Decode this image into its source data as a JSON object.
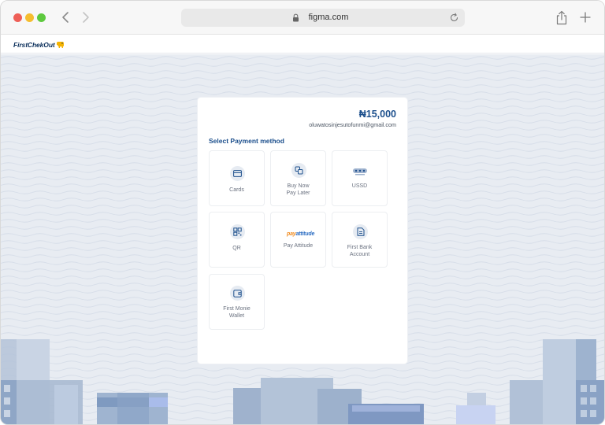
{
  "browser": {
    "url": "figma.com",
    "icons": [
      "back-chevron-icon",
      "forward-chevron-icon",
      "lock-icon",
      "reload-icon",
      "share-icon",
      "plus-icon"
    ]
  },
  "header": {
    "logo_text": "FirstChekOut"
  },
  "payment": {
    "amount": "₦15,000",
    "email": "oluwatosinjesutofunmi@gmail.com",
    "section_title": "Select Payment method",
    "methods": [
      {
        "label": "Cards",
        "icon": "card-icon"
      },
      {
        "label_line1": "Buy Now",
        "label_line2": "Pay Later",
        "icon": "bnpl-icon"
      },
      {
        "label": "USSD",
        "icon": "ussd-icon"
      },
      {
        "label": "QR",
        "icon": "qr-icon"
      },
      {
        "label": "Pay Attitude",
        "logo_part1": "pay",
        "logo_part2": "attitude",
        "icon": "payattitude-logo"
      },
      {
        "label_line1": "First Bank",
        "label_line2": "Account",
        "icon": "bank-icon"
      },
      {
        "label_line1": "First Monie",
        "label_line2": "Wallet",
        "icon": "wallet-icon"
      }
    ]
  },
  "colors": {
    "brand_blue": "#1c4f8c",
    "page_bg": "#e8ecf2",
    "logo_yellow": "#f5b301"
  }
}
